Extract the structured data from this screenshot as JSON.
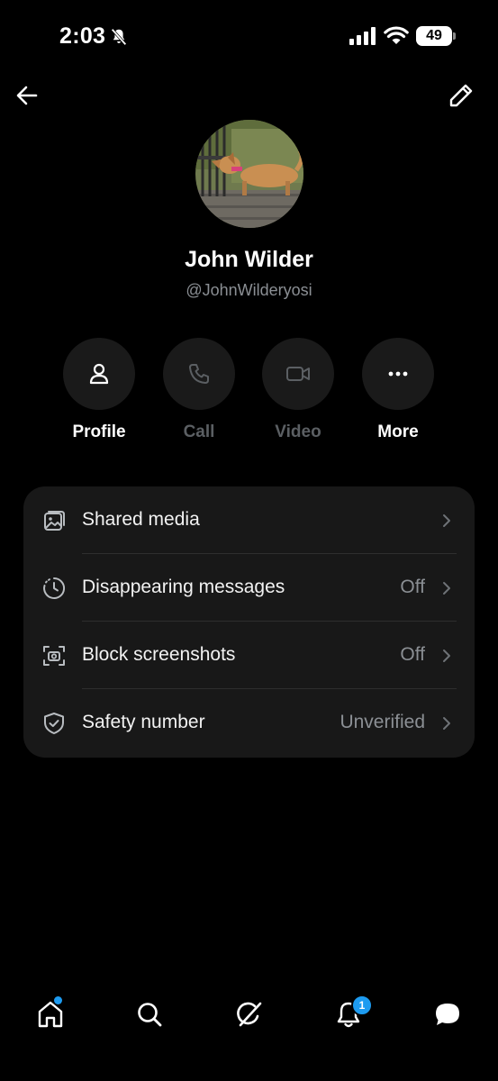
{
  "status_bar": {
    "time": "2:03",
    "battery_level": "49",
    "icons": [
      "bell-off-icon",
      "cellular-signal-icon",
      "wifi-icon",
      "battery-icon"
    ]
  },
  "header": {
    "back_icon": "back-arrow-icon",
    "edit_icon": "pencil-icon"
  },
  "profile": {
    "name": "John Wilder",
    "handle": "@JohnWilderyosi",
    "avatar": "dog-photo"
  },
  "actions": [
    {
      "label": "Profile",
      "icon": "person-icon",
      "enabled": true
    },
    {
      "label": "Call",
      "icon": "phone-icon",
      "enabled": false
    },
    {
      "label": "Video",
      "icon": "video-camera-icon",
      "enabled": false
    },
    {
      "label": "More",
      "icon": "more-dots-icon",
      "enabled": true
    }
  ],
  "settings": [
    {
      "label": "Shared media",
      "value": "",
      "icon": "image-gallery-icon"
    },
    {
      "label": "Disappearing messages",
      "value": "Off",
      "icon": "timer-icon"
    },
    {
      "label": "Block screenshots",
      "value": "Off",
      "icon": "screenshot-camera-icon"
    },
    {
      "label": "Safety number",
      "value": "Unverified",
      "icon": "shield-check-icon"
    }
  ],
  "bottom_nav": {
    "items": [
      "home-icon",
      "search-icon",
      "grok-icon",
      "notifications-icon",
      "messages-icon"
    ],
    "notification_count": "1"
  },
  "colors": {
    "background": "#000000",
    "card": "#181818",
    "accent": "#1d9bf0",
    "muted_text": "#8b8f94",
    "disabled_text": "#5b5f63"
  }
}
